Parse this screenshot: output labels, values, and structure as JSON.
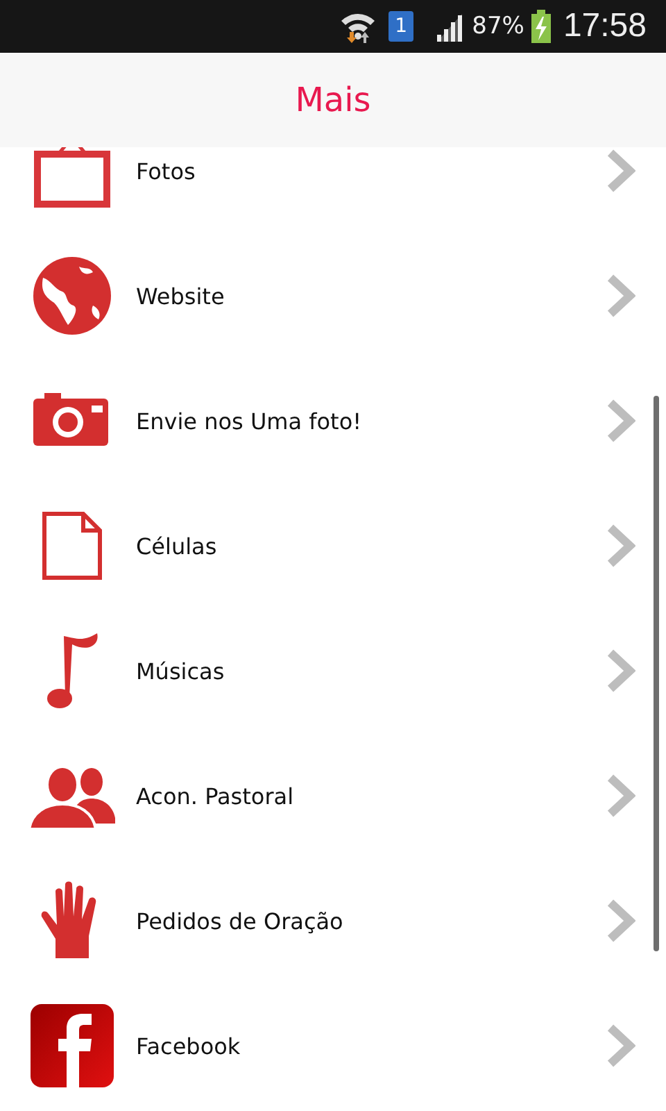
{
  "status_bar": {
    "sim": "1",
    "battery": "87%",
    "time": "17:58"
  },
  "header": {
    "title": "Mais"
  },
  "items": [
    {
      "kind": "frame",
      "label": "Fotos"
    },
    {
      "kind": "globe",
      "label": "Website"
    },
    {
      "kind": "camera",
      "label": "Envie nos Uma foto!"
    },
    {
      "kind": "document",
      "label": "Células"
    },
    {
      "kind": "note",
      "label": "Músicas"
    },
    {
      "kind": "people",
      "label": "Acon. Pastoral"
    },
    {
      "kind": "hand",
      "label": "Pedidos de Oração"
    },
    {
      "kind": "facebook",
      "label": "Facebook"
    }
  ]
}
